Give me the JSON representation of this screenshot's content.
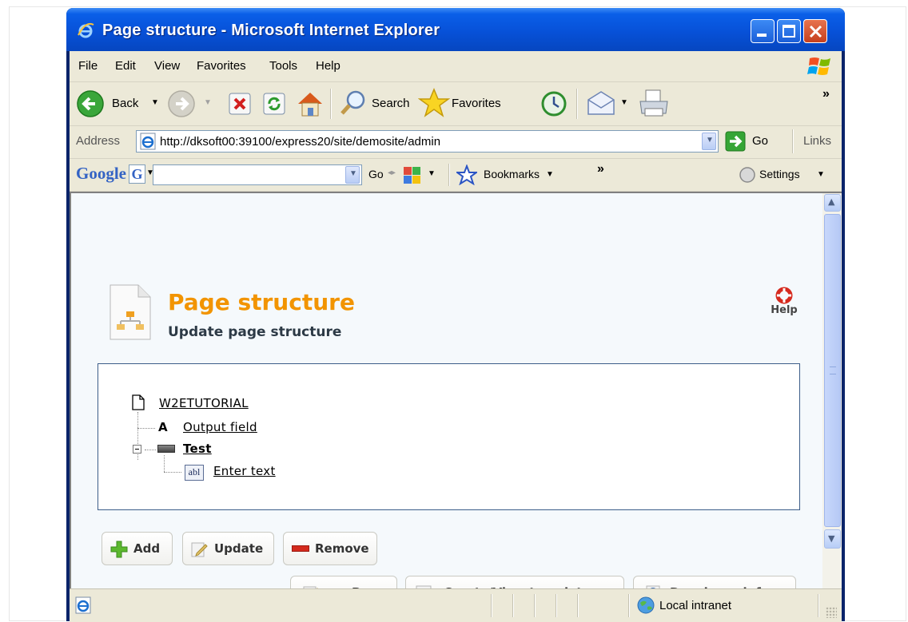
{
  "window": {
    "title": "Page structure - Microsoft Internet Explorer"
  },
  "menu": [
    "File",
    "Edit",
    "View",
    "Favorites",
    "Tools",
    "Help"
  ],
  "toolbar": {
    "back_label": "Back",
    "search_label": "Search",
    "favorites_label": "Favorites",
    "more": "»"
  },
  "address": {
    "label": "Address",
    "url": "http://dksoft00:39100/express20/site/demosite/admin",
    "go_label": "Go",
    "links_label": "Links"
  },
  "google": {
    "logo": "Google",
    "go_label": "Go",
    "bookmarks_label": "Bookmarks",
    "more": "»",
    "settings_label": "Settings"
  },
  "page": {
    "title": "Page structure",
    "subtitle": "Update page structure",
    "help_label": "Help",
    "tree": {
      "root": "W2ETUTORIAL",
      "items": [
        {
          "icon_text": "A",
          "label": "Output field",
          "level": 1
        },
        {
          "icon_text": "",
          "label": "Test",
          "level": 1,
          "bold": true
        },
        {
          "icon_text": "abl",
          "label": "Enter text",
          "level": 2
        }
      ]
    },
    "buttons": {
      "add": "Add",
      "update": "Update",
      "remove": "Remove",
      "pages": "Pages",
      "template": "Create/View template",
      "developer": "Developer info"
    }
  },
  "status": {
    "zone": "Local intranet"
  },
  "colors": {
    "title_orange": "#f29400",
    "xp_blue": "#0751d8",
    "tree_border": "#3c5d89"
  }
}
